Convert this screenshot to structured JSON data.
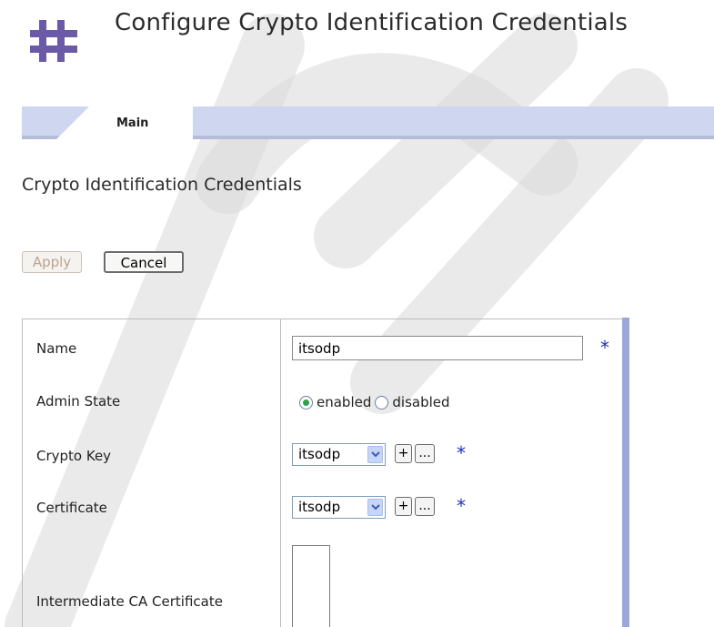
{
  "header": {
    "title": "Configure Crypto Identification Credentials",
    "logo_icon": "hash-grid-icon",
    "logo_color": "#6a5aa8"
  },
  "tabs": [
    {
      "label": "Main",
      "active": true
    }
  ],
  "section": {
    "title": "Crypto Identification Credentials"
  },
  "buttons": {
    "apply": "Apply",
    "cancel": "Cancel"
  },
  "form": {
    "name": {
      "label": "Name",
      "value": "itsodp",
      "required_mark": "*"
    },
    "admin_state": {
      "label": "Admin State",
      "options": [
        "enabled",
        "disabled"
      ],
      "selected": "enabled"
    },
    "crypto_key": {
      "label": "Crypto Key",
      "value": "itsodp",
      "add": "+",
      "more": "...",
      "required_mark": "*"
    },
    "certificate": {
      "label": "Certificate",
      "value": "itsodp",
      "add": "+",
      "more": "...",
      "required_mark": "*"
    },
    "intermediate_ca": {
      "label": "Intermediate CA Certificate"
    }
  },
  "colors": {
    "tabbar": "#cfd6ef",
    "accent_bar": "#9aa7d9",
    "required": "#1f2fbf"
  }
}
